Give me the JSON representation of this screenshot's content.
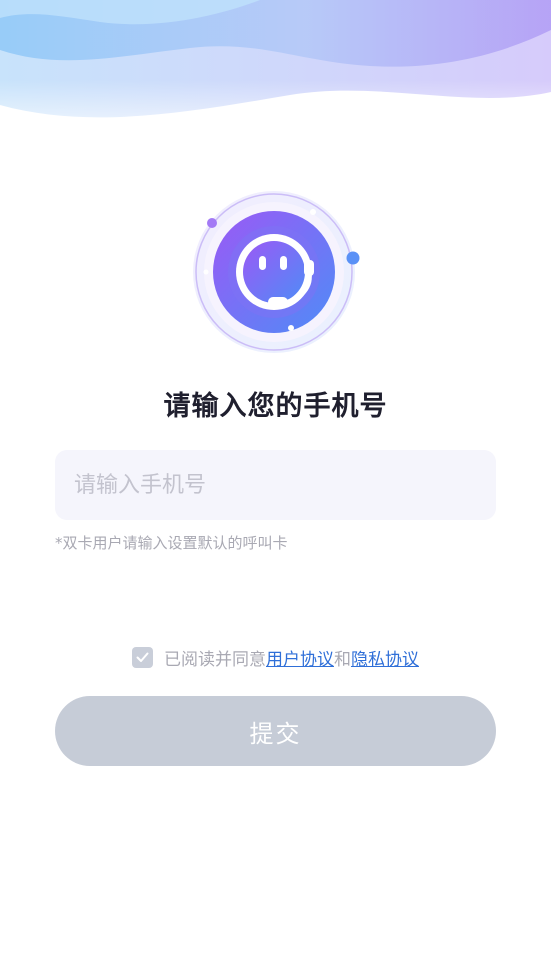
{
  "header": {
    "title": "请输入您的手机号"
  },
  "form": {
    "phone_placeholder": "请输入手机号",
    "phone_value": "",
    "hint": "*双卡用户请输入设置默认的呼叫卡"
  },
  "agreement": {
    "checked": true,
    "prefix": "已阅读并同意",
    "user_agreement_link": "用户协议",
    "conjunction": "和",
    "privacy_link": "隐私协议"
  },
  "submit": {
    "label": "提交"
  },
  "icons": {
    "logo": "chat-robot-headset-icon",
    "checkbox": "check-icon"
  },
  "colors": {
    "title": "#1f1f2e",
    "link": "#2f6fd8",
    "button_disabled": "#c6ccd7",
    "input_bg": "#f5f5fc",
    "logo_gradient_start": "#9b59f5",
    "logo_gradient_end": "#4f8cf7"
  }
}
